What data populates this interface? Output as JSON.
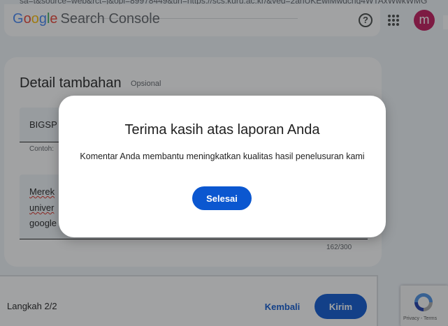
{
  "background_page": {
    "url_fragment": "sa=t&source=web&rct=j&opi=89978449&url=https://scs.kuru.ac.kr/&ved=2ahUKEwiMwdcng4WTAxWwkWMG",
    "app_logo": {
      "letters": [
        "G",
        "o",
        "o",
        "g",
        "l",
        "e"
      ],
      "product": "Search Console"
    },
    "avatar_initial": "m",
    "detail_section": {
      "title": "Detail tambahan",
      "optional_label": "Opsional",
      "field1_value": "BIGSP",
      "field1_hint": "Contoh:",
      "field2_lines": [
        "Merek",
        "univer",
        "google"
      ],
      "field2_counter": "162/300"
    },
    "footer": {
      "step_label": "Langkah 2/2",
      "back_label": "Kembali",
      "send_label": "Kirim"
    },
    "recaptcha": {
      "links": "Privacy - Terms"
    }
  },
  "dialog": {
    "title": "Terima kasih atas laporan Anda",
    "body": "Komentar Anda membantu meningkatkan kualitas hasil penelusuran kami",
    "done_label": "Selesai"
  },
  "colors": {
    "primary_blue": "#0b57d0",
    "avatar": "#c2185b",
    "scrim": "rgba(32,33,36,0.42)"
  },
  "icons": [
    "help-icon",
    "apps-grid-icon",
    "recaptcha-icon"
  ]
}
